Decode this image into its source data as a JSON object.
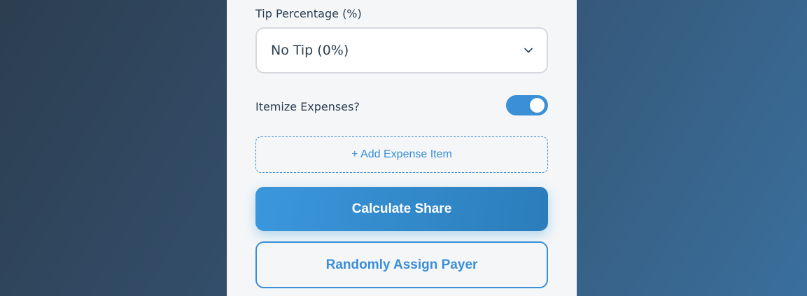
{
  "tip": {
    "label": "Tip Percentage (%)",
    "selected": "No Tip (0%)",
    "chevron_icon": "chevron-down-icon"
  },
  "itemize": {
    "label": "Itemize Expenses?",
    "enabled": true
  },
  "add_item": {
    "label": "+ Add Expense Item"
  },
  "actions": {
    "calculate_label": "Calculate Share",
    "random_label": "Randomly Assign Payer"
  },
  "colors": {
    "accent": "#3a8fd6",
    "text": "#2c3e50",
    "panel_bg": "#f4f6f8",
    "page_bg_start": "#2c3e50",
    "page_bg_end": "#3a6f9c"
  }
}
